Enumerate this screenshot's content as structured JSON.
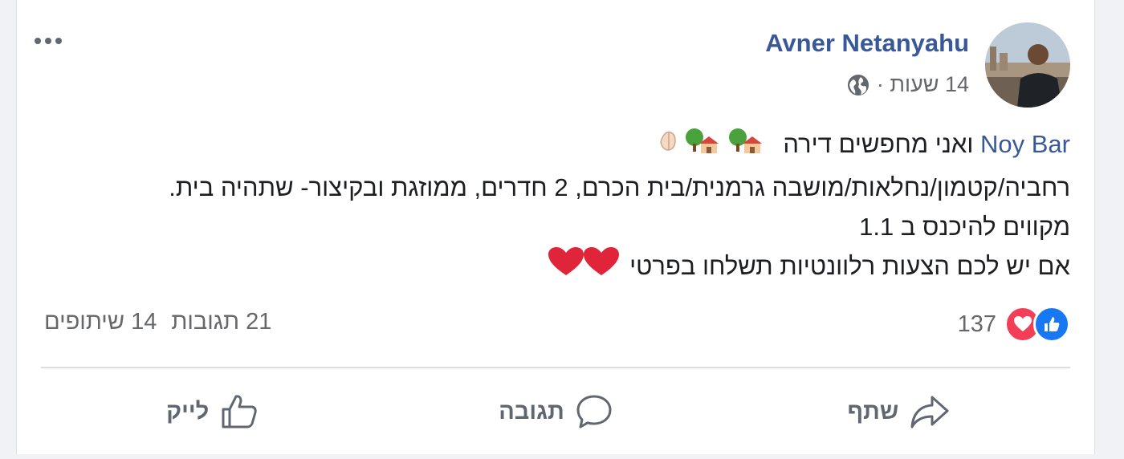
{
  "post": {
    "author": "Avner Netanyahu",
    "time": "14 שעות ·",
    "mention": "Noy Bar",
    "line1_text": " ואני מחפשים דירה ",
    "line2": "רחביה/קטמון/נחלאות/מושבה גרמנית/בית הכרם, 2 חדרים, ממוזגת ובקיצור- שתהיה בית.",
    "line3": "מקווים להיכנס ב 1.1",
    "line4": "אם יש לכם הצעות רלוונטיות תשלחו בפרטי ",
    "line1_emoji": "🙏🏻🏡🏡",
    "line4_emoji": "❤️❤️"
  },
  "stats": {
    "reaction_count": "137",
    "comments": "21 תגובות",
    "shares": "14 שיתופים"
  },
  "actions": {
    "like": "לייק",
    "comment": "תגובה",
    "share": "שתף"
  },
  "colors": {
    "link": "#385898",
    "like": "#1877f2",
    "love": "#f33e58",
    "muted": "#65676b"
  },
  "icons": [
    "more-options-icon",
    "globe-icon",
    "like-reaction-icon",
    "love-reaction-icon",
    "thumbs-up-icon",
    "comment-icon",
    "share-icon"
  ]
}
